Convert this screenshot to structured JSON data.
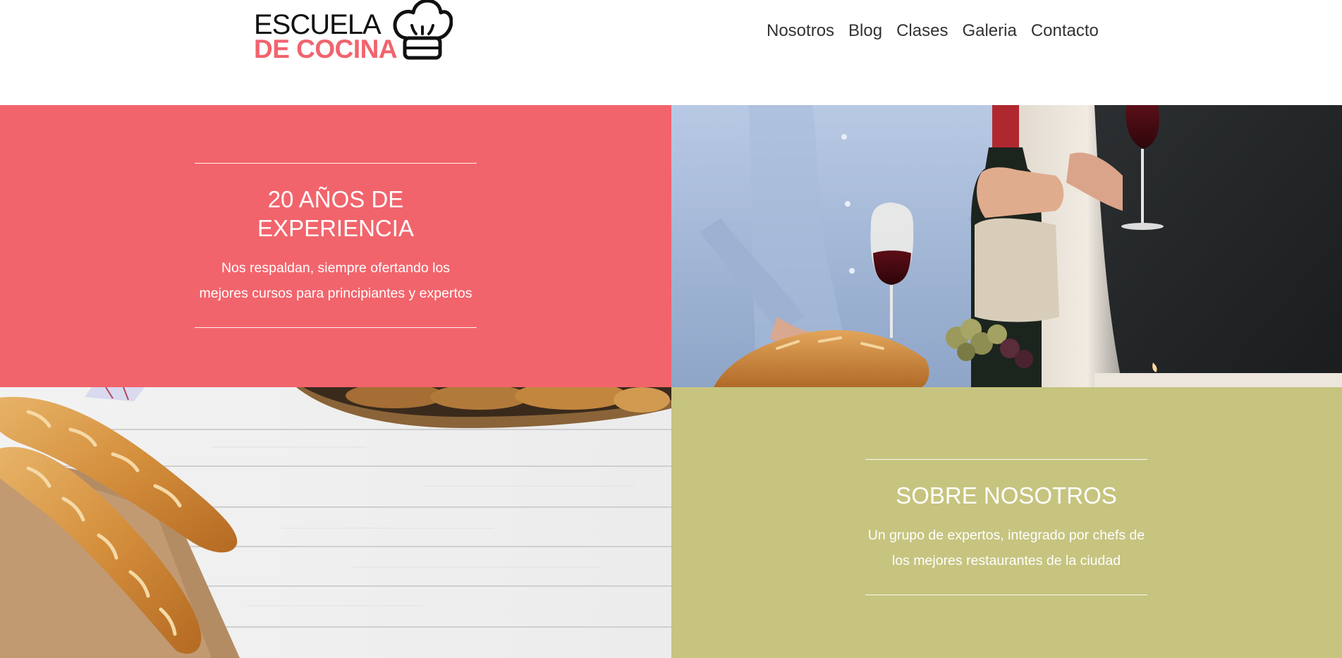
{
  "header": {
    "logo": {
      "line1": "ESCUELA",
      "line2": "DE COCINA",
      "icon": "chef-hat-icon",
      "accent_color": "#f0646e"
    },
    "nav": [
      {
        "label": "Nosotros"
      },
      {
        "label": "Blog"
      },
      {
        "label": "Clases"
      },
      {
        "label": "Galeria"
      },
      {
        "label": "Contacto"
      }
    ]
  },
  "sections": {
    "experience": {
      "title_line1": "20 AÑOS DE",
      "title_line2": "EXPERIENCIA",
      "text_line1": "Nos respaldan, siempre ofertando los",
      "text_line2": "mejores cursos para principiantes y expertos",
      "background_color": "#f2646c"
    },
    "about": {
      "title": "SOBRE NOSOTROS",
      "text_line1": "Un grupo de expertos, integrado por chefs de",
      "text_line2": "los mejores restaurantes de la ciudad",
      "background_color": "#c6c47f"
    },
    "photos": {
      "wine": "wine-dinner-photo",
      "bread": "baguettes-on-wood-photo"
    }
  }
}
